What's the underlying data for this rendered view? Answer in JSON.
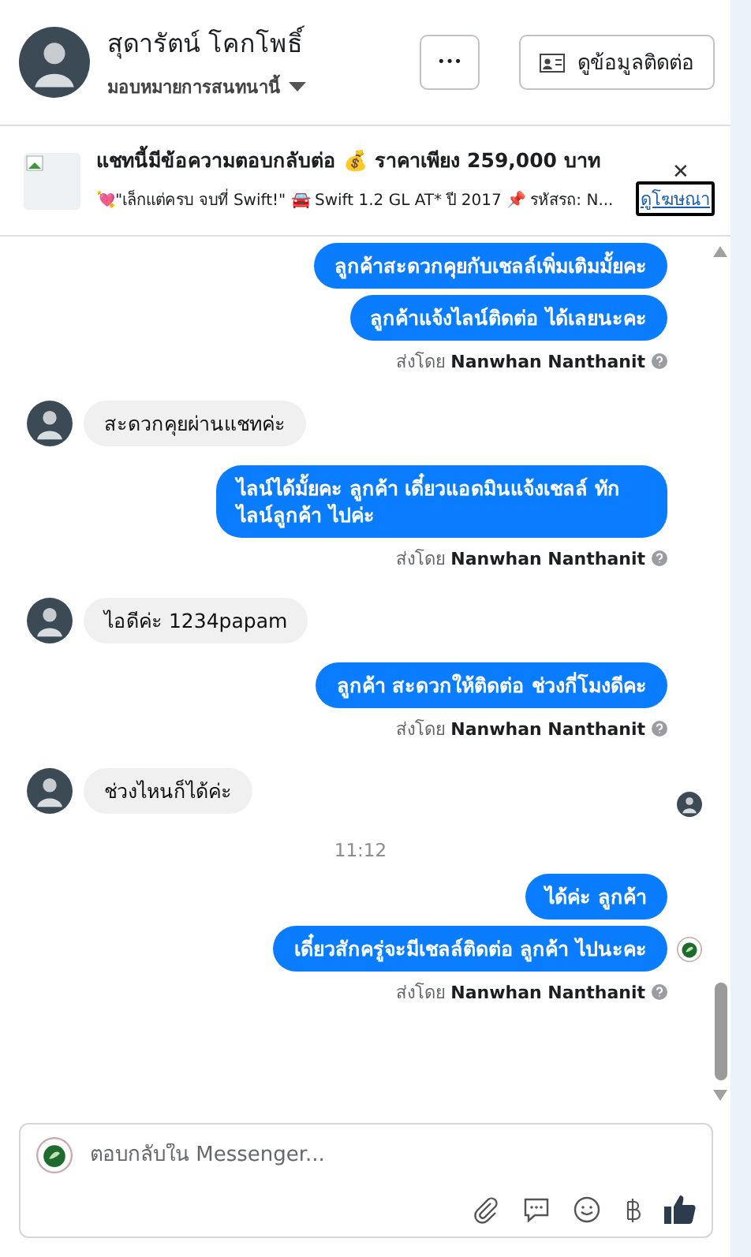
{
  "header": {
    "name": "สุดารัตน์ โคกโพธิ์",
    "assign": "มอบหมายการสนทนานี้",
    "more": "•••",
    "contact_button": "ดูข้อมูลติดต่อ"
  },
  "banner": {
    "title": "แชทนี้มีข้อความตอบกลับต่อ 💰 ราคาเพียง 259,000 บาท",
    "subtitle": "💘\"เล็กแต่ครบ จบที่ Swift!\" 🚘 Swift 1.2 GL AT* ปี 2017 📌 รหัสรถ: N...",
    "link": "ดูโฆษณา",
    "close": "✕"
  },
  "messages": [
    {
      "kind": "outgoing",
      "text": "ลูกค้าสะดวกคุยกับเชลล์เพิ่มเติมมั้ยคะ"
    },
    {
      "kind": "outgoing",
      "text": "ลูกค้าแจ้งไลน์ติดต่อ ได้เลยนะคะ"
    },
    {
      "kind": "sent_by",
      "label": "ส่งโดย",
      "name": "Nanwhan Nanthanit"
    },
    {
      "kind": "incoming",
      "text": "สะดวกคุยผ่านแชทค่ะ"
    },
    {
      "kind": "outgoing",
      "text": "ไลน์ได้มั้ยคะ  ลูกค้า  เดี๋ยวแอดมินแจ้งเชลล์ ทักไลน์ลูกค้า ไปค่ะ"
    },
    {
      "kind": "sent_by",
      "label": "ส่งโดย",
      "name": "Nanwhan Nanthanit"
    },
    {
      "kind": "incoming",
      "text": "ไอดีค่ะ 1234papam"
    },
    {
      "kind": "outgoing",
      "text": "ลูกค้า สะดวกให้ติดต่อ ช่วงกี่โมงดีคะ"
    },
    {
      "kind": "sent_by",
      "label": "ส่งโดย",
      "name": "Nanwhan Nanthanit"
    },
    {
      "kind": "incoming",
      "text": "ช่วงไหนก็ได้ค่ะ",
      "seen": true
    },
    {
      "kind": "time",
      "text": "11:12"
    },
    {
      "kind": "outgoing",
      "text": "ได้ค่ะ  ลูกค้า"
    },
    {
      "kind": "outgoing",
      "text": "เดี๋ยวสักครู่จะมีเชลล์ติดต่อ ลูกค้า ไปนะคะ",
      "seen": true
    },
    {
      "kind": "sent_by",
      "label": "ส่งโดย",
      "name": "Nanwhan Nanthanit"
    }
  ],
  "composer": {
    "placeholder": "ตอบกลับใน Messenger..."
  }
}
